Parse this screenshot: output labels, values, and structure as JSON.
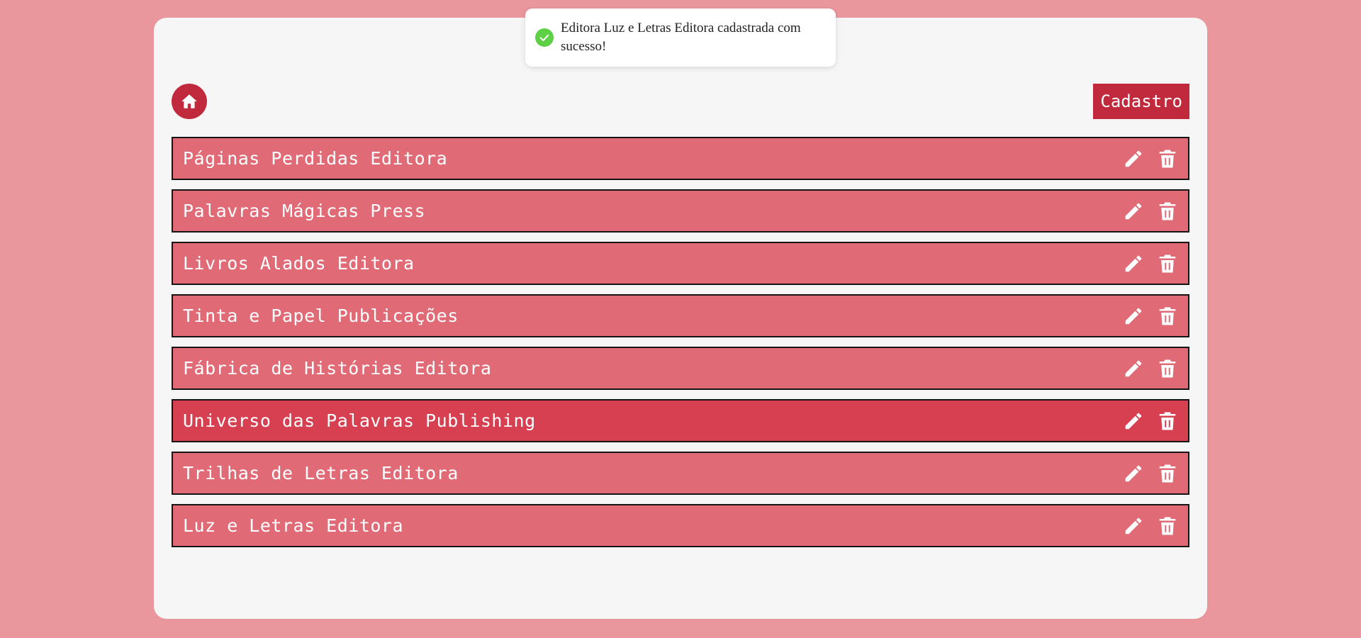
{
  "toast": {
    "message": "Editora Luz e Letras Editora cadastrada com sucesso!",
    "status_color": "#5ed045"
  },
  "header": {
    "home_icon": "home-icon",
    "cadastro_label": "Cadastro"
  },
  "colors": {
    "background": "#e9979d",
    "panel": "#f6f6f6",
    "accent": "#c12a3c",
    "row": "#e06b77",
    "row_active": "#d74050"
  },
  "publishers": [
    {
      "name": "Páginas Perdidas Editora"
    },
    {
      "name": "Palavras Mágicas Press"
    },
    {
      "name": "Livros Alados Editora"
    },
    {
      "name": "Tinta e Papel Publicações"
    },
    {
      "name": "Fábrica de Histórias Editora"
    },
    {
      "name": "Universo das Palavras Publishing"
    },
    {
      "name": "Trilhas de Letras Editora"
    },
    {
      "name": "Luz e Letras Editora"
    }
  ],
  "row_actions": {
    "edit_icon": "pencil-icon",
    "delete_icon": "trash-icon"
  }
}
